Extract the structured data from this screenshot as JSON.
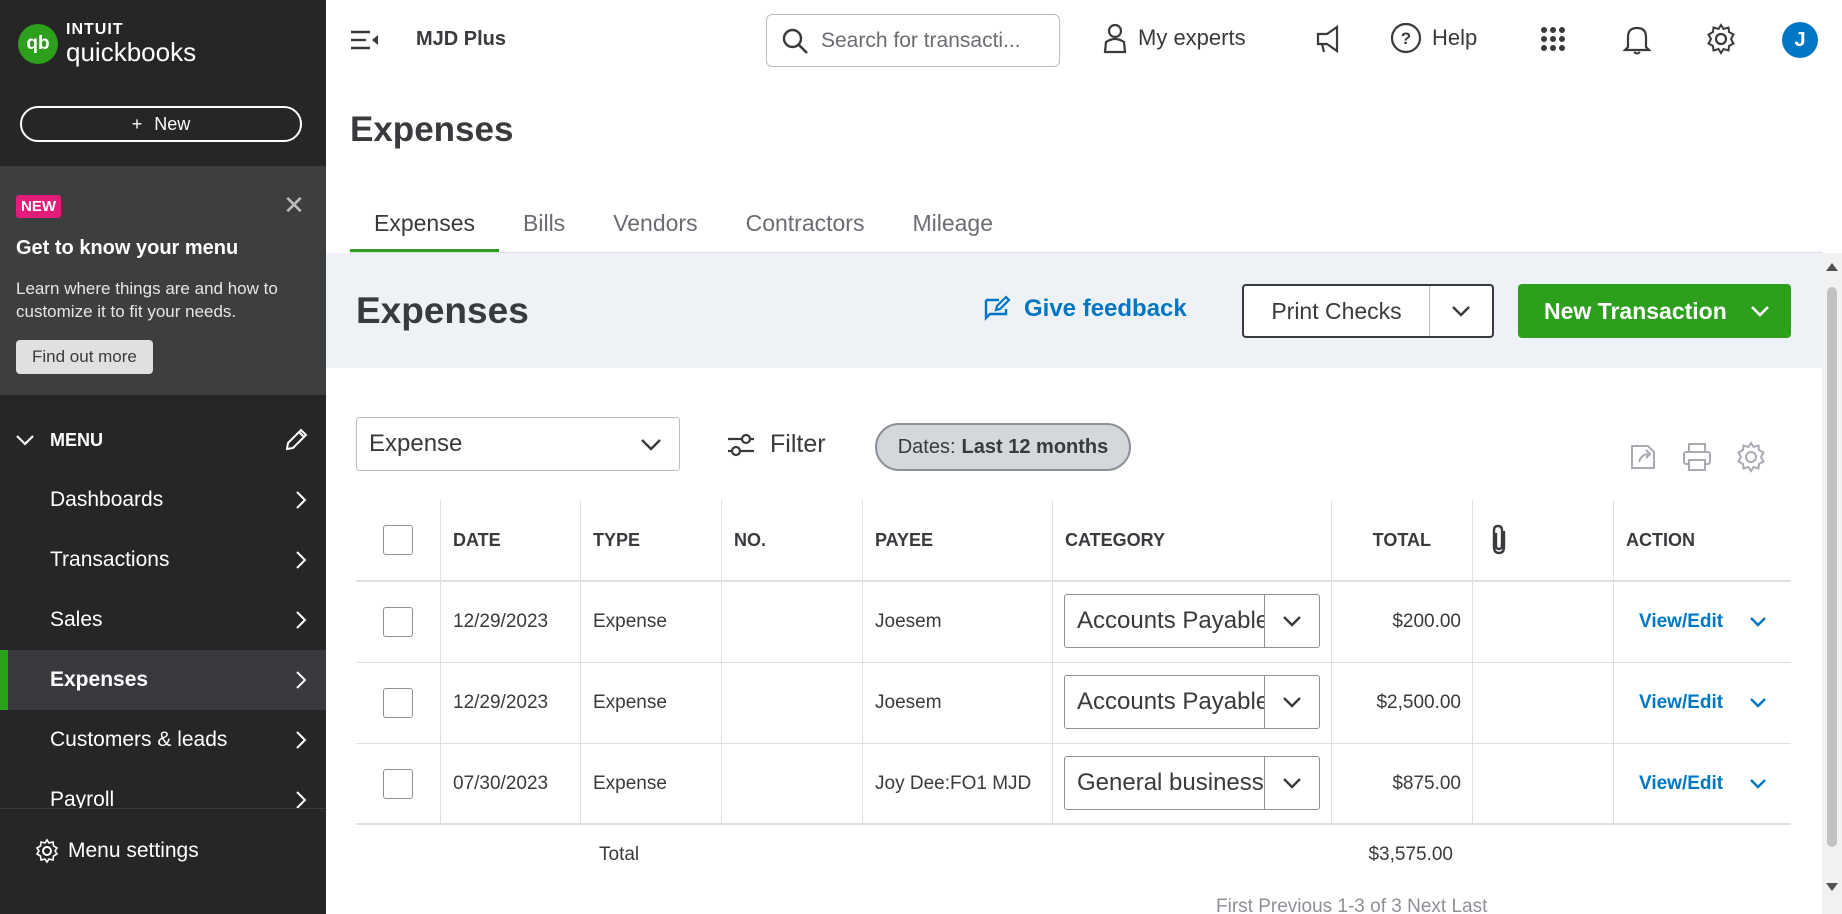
{
  "brand": {
    "intuit": "INTUIT",
    "product": "quickbooks",
    "logo_mark": "qb",
    "accent": "#2ca01c"
  },
  "sidebar": {
    "new_label": "New",
    "promo": {
      "badge": "NEW",
      "title": "Get to know your menu",
      "description": "Learn where things are and how to customize it to fit your needs.",
      "button": "Find out more"
    },
    "menu_label": "MENU",
    "items": [
      {
        "label": "Dashboards",
        "active": false
      },
      {
        "label": "Transactions",
        "active": false
      },
      {
        "label": "Sales",
        "active": false
      },
      {
        "label": "Expenses",
        "active": true
      },
      {
        "label": "Customers & leads",
        "active": false
      },
      {
        "label": "Payroll",
        "active": false
      }
    ],
    "menu_settings": "Menu settings"
  },
  "topbar": {
    "company": "MJD Plus",
    "search_placeholder": "Search for transacti...",
    "my_experts": "My experts",
    "help": "Help",
    "avatar_initial": "J"
  },
  "page": {
    "title": "Expenses",
    "tabs": [
      "Expenses",
      "Bills",
      "Vendors",
      "Contractors",
      "Mileage"
    ],
    "active_tab": "Expenses"
  },
  "band": {
    "title": "Expenses",
    "feedback": "Give feedback",
    "print_checks": "Print Checks",
    "new_transaction": "New Transaction"
  },
  "filters": {
    "type_value": "Expense",
    "filter_label": "Filter",
    "date_prefix": "Dates:",
    "date_value": "Last 12 months"
  },
  "table": {
    "headers": {
      "date": "DATE",
      "type": "TYPE",
      "no": "NO.",
      "payee": "PAYEE",
      "category": "CATEGORY",
      "total": "TOTAL",
      "action": "ACTION"
    },
    "rows": [
      {
        "date": "12/29/2023",
        "type": "Expense",
        "no": "",
        "payee": "Joesem",
        "category": "Accounts Payable (A/P)",
        "total": "$200.00",
        "action": "View/Edit"
      },
      {
        "date": "12/29/2023",
        "type": "Expense",
        "no": "",
        "payee": "Joesem",
        "category": "Accounts Payable (A/P)",
        "total": "$2,500.00",
        "action": "View/Edit"
      },
      {
        "date": "07/30/2023",
        "type": "Expense",
        "no": "",
        "payee": "Joy Dee:FO1 MJD",
        "category": "General business expenses",
        "total": "$875.00",
        "action": "View/Edit"
      }
    ],
    "total_label": "Total",
    "total_value": "$3,575.00"
  },
  "pager": "First    Previous    1-3 of 3    Next    Last"
}
